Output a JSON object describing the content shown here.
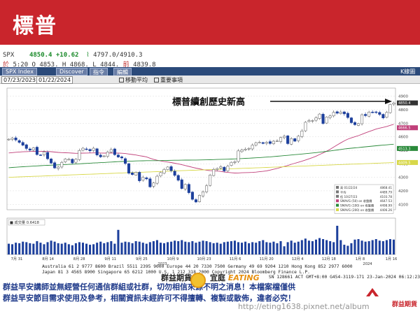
{
  "banner": {
    "title": "標普"
  },
  "quote": {
    "symbol": "SPX",
    "last": "4850.4",
    "change": "+10.62",
    "range_low": "4797.0",
    "range_high": "4910.3",
    "line2_prefix": "於",
    "time": "5:20",
    "open_label": "O",
    "open": "4853.",
    "high_label": "H",
    "high": "4868.",
    "low_label": "L",
    "low": "4844.",
    "prev_label": "前",
    "prev": "4839.8"
  },
  "toolbar": {
    "index_label": "SPX Index",
    "discover": "Discover",
    "index_menu": "指令",
    "edit_menu": "編輯",
    "right_tag": "K線圖",
    "date_from": "07/23/2023",
    "date_to": "01/22/2024",
    "option1": "移動平均",
    "option2": "重要事項"
  },
  "chart_data": {
    "type": "candlestick",
    "annotation": "標普續創歷史新高",
    "x_tick_labels": [
      "7月 31",
      "8月 14",
      "8月 28",
      "9月 11",
      "9月 25",
      "10月 9",
      "10月 23",
      "11月 6",
      "11月 20",
      "12月 4",
      "12月 18",
      "1月 8",
      "1月 16"
    ],
    "year_labels": [
      "2023",
      "2024"
    ],
    "y_ticks": [
      4100,
      4200,
      4300,
      4400,
      4500,
      4600,
      4700,
      4800,
      4900
    ],
    "ylim": [
      4060,
      4960
    ],
    "right_labels": [
      {
        "value": "4850.4",
        "color": "#333333"
      },
      {
        "value": "4666.5",
        "color": "#c0407a"
      },
      {
        "value": "4513.3",
        "color": "#2a8a3a"
      },
      {
        "value": "4409.5",
        "color": "#d8d84a"
      }
    ],
    "legend": [
      {
        "text": "高 01/22/24",
        "value": "4868.41",
        "color": "#777777"
      },
      {
        "text": "平均",
        "value": "4489.79",
        "color": "#777777"
      },
      {
        "text": "低 10/27/23",
        "value": "4103.78",
        "color": "#777777"
      },
      {
        "text": "SMAVG (50) on 收盤價",
        "value": "4647.53",
        "color": "#c0407a"
      },
      {
        "text": "SMAVG (100) on 收盤價",
        "value": "4498.99",
        "color": "#2a8a3a"
      },
      {
        "text": "SMAVG (200) on 收盤價",
        "value": "4406.26",
        "color": "#d8d84a"
      }
    ],
    "price_series": [
      4582,
      4589,
      4576,
      4558,
      4537,
      4513,
      4501,
      4518,
      4468,
      4464,
      4489,
      4437,
      4405,
      4369,
      4376,
      4410,
      4436,
      4433,
      4406,
      4433,
      4498,
      4515,
      4507,
      4496,
      4515,
      4465,
      4451,
      4458,
      4487,
      4505,
      4467,
      4450,
      4443,
      4402,
      4330,
      4320,
      4337,
      4274,
      4299,
      4288,
      4229,
      4258,
      4308,
      4335,
      4358,
      4376,
      4349,
      4314,
      4278,
      4217,
      4247,
      4186,
      4137,
      4117,
      4167,
      4193,
      4237,
      4317,
      4358,
      4365,
      4378,
      4347,
      4382,
      4411,
      4415,
      4495,
      4502,
      4508,
      4514,
      4538,
      4556,
      4560,
      4550,
      4559,
      4550,
      4567,
      4569,
      4594,
      4604,
      4549,
      4586,
      4567,
      4604,
      4643,
      4707,
      4719,
      4720,
      4740,
      4768,
      4698,
      4746,
      4754,
      4781,
      4774,
      4783,
      4769,
      4742,
      4704,
      4689,
      4697,
      4763,
      4756,
      4783,
      4780,
      4783,
      4765,
      4739,
      4780,
      4839,
      4850
    ],
    "volume_title": "成交量",
    "volume_value": "0.6418",
    "volume_series": [
      2.1,
      2.0,
      2.3,
      2.2,
      2.5,
      2.4,
      2.2,
      2.1,
      2.6,
      2.3,
      2.0,
      2.4,
      2.7,
      2.5,
      2.2,
      2.1,
      2.3,
      2.0,
      1.8,
      2.2,
      2.4,
      2.3,
      2.1,
      1.9,
      2.0,
      2.3,
      2.5,
      2.2,
      2.4,
      2.6,
      2.1,
      4.8,
      2.3,
      2.5,
      2.4,
      2.2,
      2.6,
      2.5,
      2.3,
      2.1,
      2.4,
      2.6,
      2.8,
      2.3,
      2.2,
      2.4,
      2.5,
      2.7,
      2.6,
      2.8,
      2.5,
      2.4,
      2.6,
      2.3,
      2.5,
      2.7,
      2.6,
      2.4,
      2.2,
      2.3,
      2.1,
      2.4,
      2.5,
      2.6,
      2.7,
      2.4,
      2.3,
      2.5,
      2.2,
      2.4,
      2.3,
      2.6,
      2.8,
      2.4,
      2.3,
      2.5,
      2.2,
      2.6,
      1.6,
      2.4,
      2.7,
      2.3,
      2.5,
      2.8,
      3.1,
      2.7,
      2.6,
      2.9,
      3.2,
      3.0,
      2.8,
      2.6,
      2.4,
      5.6,
      2.8,
      1.9,
      1.7,
      2.2,
      2.9,
      3.0,
      2.7,
      2.5,
      2.6,
      2.8,
      3.0,
      2.7,
      2.6,
      2.8,
      3.0,
      2.9
    ]
  },
  "footer": {
    "line1": "Australia 61 2 9777 8600 Brazil 5511 2395 9000 Europe 44 20 7330 7500 Germany 49 69 9204 1210 Hong Kong 852 2977 6000",
    "line2": "Japan 81 3 4565 8900          Singapore 65 6212 1000          U.S. 1 212 318 2000        Copyright 2024 Bloomberg Finance L.P.",
    "line3": "SN 128661 ACT  GMT+8:00 G454-3119-171 23-Jan-2024 06:12:23"
  },
  "branding": {
    "left_logo": "群益期貨",
    "mid_logo": "宜庭",
    "eating": "EATING",
    "right_logo": "群益期貨"
  },
  "disclaimer": {
    "line1": "群益早安講師並無經營任何通信群組或社群，切勿相信來源不明之消息！本檔案檔僅供",
    "line2": "群益早安節目需求使用及參考，相關資訊未經許可不得擅轉、複製或散佈，違者必究！"
  },
  "watermark": "http://eting1638.pixnet.net/album"
}
